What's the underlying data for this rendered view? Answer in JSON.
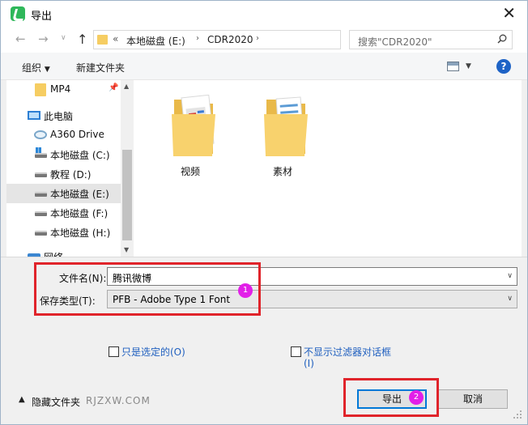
{
  "window": {
    "title": "导出"
  },
  "address": {
    "overflow": "«",
    "crumbs": [
      "本地磁盘 (E:)",
      "CDR2020"
    ],
    "search_placeholder": "搜索\"CDR2020\""
  },
  "toolbar": {
    "organize": "组织",
    "new_folder": "新建文件夹"
  },
  "nav_pane": {
    "items": [
      {
        "label": "MP4",
        "icon": "folder-icon",
        "pinned": true
      },
      {
        "label": "此电脑",
        "icon": "pc-icon"
      },
      {
        "label": "A360 Drive",
        "icon": "cloud-drive-icon"
      },
      {
        "label": "本地磁盘 (C:)",
        "icon": "windows-drive-icon"
      },
      {
        "label": "教程 (D:)",
        "icon": "drive-icon"
      },
      {
        "label": "本地磁盘 (E:)",
        "icon": "drive-icon",
        "selected": true
      },
      {
        "label": "本地磁盘 (F:)",
        "icon": "drive-icon"
      },
      {
        "label": "本地磁盘 (H:)",
        "icon": "drive-icon"
      },
      {
        "label": "网络",
        "icon": "network-icon"
      }
    ]
  },
  "files": [
    {
      "name": "视频",
      "icon": "folder-with-images-icon"
    },
    {
      "name": "素材",
      "icon": "folder-with-documents-icon"
    }
  ],
  "form": {
    "filename_label": "文件名(N):",
    "filename_value": "腾讯微博",
    "filetype_label": "保存类型(T):",
    "filetype_value": "PFB - Adobe Type 1 Font"
  },
  "options": {
    "selected_only": "只是选定的(O)",
    "no_filter_dialog_line1": "不显示过滤器对话框",
    "no_filter_dialog_line2": "(I)"
  },
  "footer": {
    "hide_folders": "隐藏文件夹",
    "watermark": "RJZXW.COM"
  },
  "buttons": {
    "export": "导出",
    "cancel": "取消"
  },
  "annotations": {
    "badge1": "1",
    "badge2": "2",
    "highlight_color": "#e0242b",
    "badge_color": "#e21fe8"
  }
}
